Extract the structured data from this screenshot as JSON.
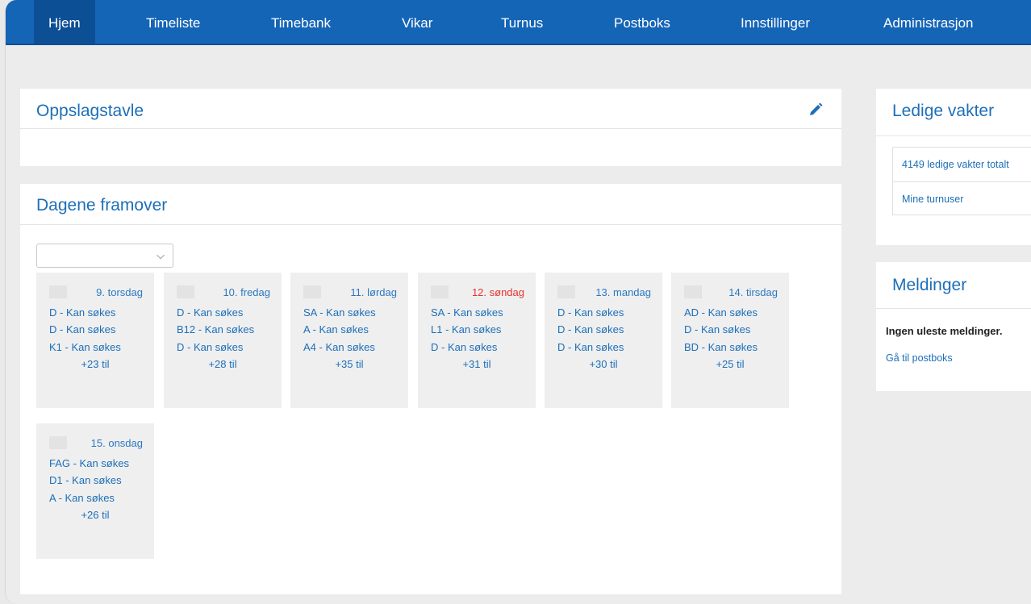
{
  "nav": {
    "items": [
      "Hjem",
      "Timeliste",
      "Timebank",
      "Vikar",
      "Turnus",
      "Postboks",
      "Innstillinger",
      "Administrasjon"
    ],
    "active": "Hjem",
    "color": "#1565b7"
  },
  "bulletin": {
    "title": "Oppslagstavle",
    "edit_icon": "pencil-icon"
  },
  "upcoming": {
    "title": "Dagene framover",
    "select_value": "",
    "days": [
      {
        "title": "9. torsdag",
        "shifts": [
          "D - Kan søkes",
          "D - Kan søkes",
          "K1 - Kan søkes"
        ],
        "more": "+23 til"
      },
      {
        "title": "10. fredag",
        "shifts": [
          "D - Kan søkes",
          "B12 - Kan søkes",
          "D - Kan søkes"
        ],
        "more": "+28 til"
      },
      {
        "title": "11. lørdag",
        "shifts": [
          "SA - Kan søkes",
          "A - Kan søkes",
          "A4 - Kan søkes"
        ],
        "more": "+35 til"
      },
      {
        "title": "12. søndag",
        "shifts": [
          "SA - Kan søkes",
          "L1 - Kan søkes",
          "D - Kan søkes"
        ],
        "more": "+31 til"
      },
      {
        "title": "13. mandag",
        "shifts": [
          "D - Kan søkes",
          "D - Kan søkes",
          "D - Kan søkes"
        ],
        "more": "+30 til"
      },
      {
        "title": "14. tirsdag",
        "shifts": [
          "AD - Kan søkes",
          "D - Kan søkes",
          "BD - Kan søkes"
        ],
        "more": "+25 til"
      },
      {
        "title": "15. onsdag",
        "shifts": [
          "FAG - Kan søkes",
          "D1 - Kan søkes",
          "A - Kan søkes"
        ],
        "more": "+26 til"
      }
    ],
    "sunday_color": "#e8322c"
  },
  "vacant": {
    "title": "Ledige vakter",
    "total": "4149 ledige vakter totalt",
    "my_rotations": "Mine turnuser"
  },
  "messages": {
    "title": "Meldinger",
    "none": "Ingen uleste meldinger.",
    "goto": "Gå til postboks"
  }
}
